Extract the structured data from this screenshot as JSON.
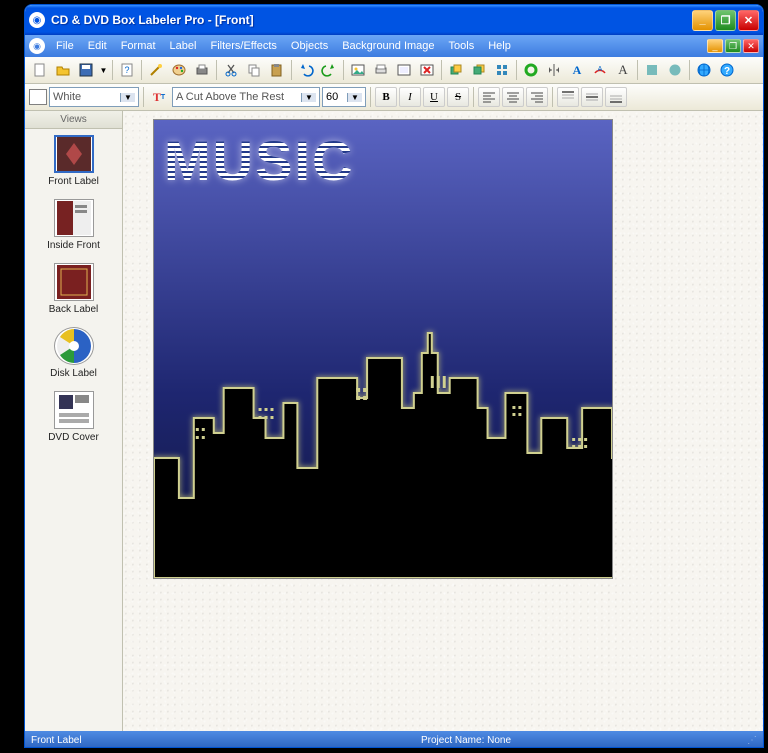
{
  "titlebar": {
    "title": "CD & DVD Box Labeler Pro - [Front]"
  },
  "menu": {
    "items": [
      "File",
      "Edit",
      "Format",
      "Label",
      "Filters/Effects",
      "Objects",
      "Background Image",
      "Tools",
      "Help"
    ]
  },
  "toolbar2": {
    "color_name": "White",
    "font_name": "A Cut Above The Rest",
    "font_size": "60",
    "bold": "B",
    "italic": "I",
    "underline": "U",
    "strike": "S"
  },
  "sidebar": {
    "header": "Views",
    "items": [
      {
        "label": "Front Label"
      },
      {
        "label": "Inside Front"
      },
      {
        "label": "Back Label"
      },
      {
        "label": "Disk Label"
      },
      {
        "label": "DVD Cover"
      }
    ]
  },
  "canvas": {
    "text": "MUSIC"
  },
  "status": {
    "left": "Front Label",
    "right": "Project Name: None"
  }
}
